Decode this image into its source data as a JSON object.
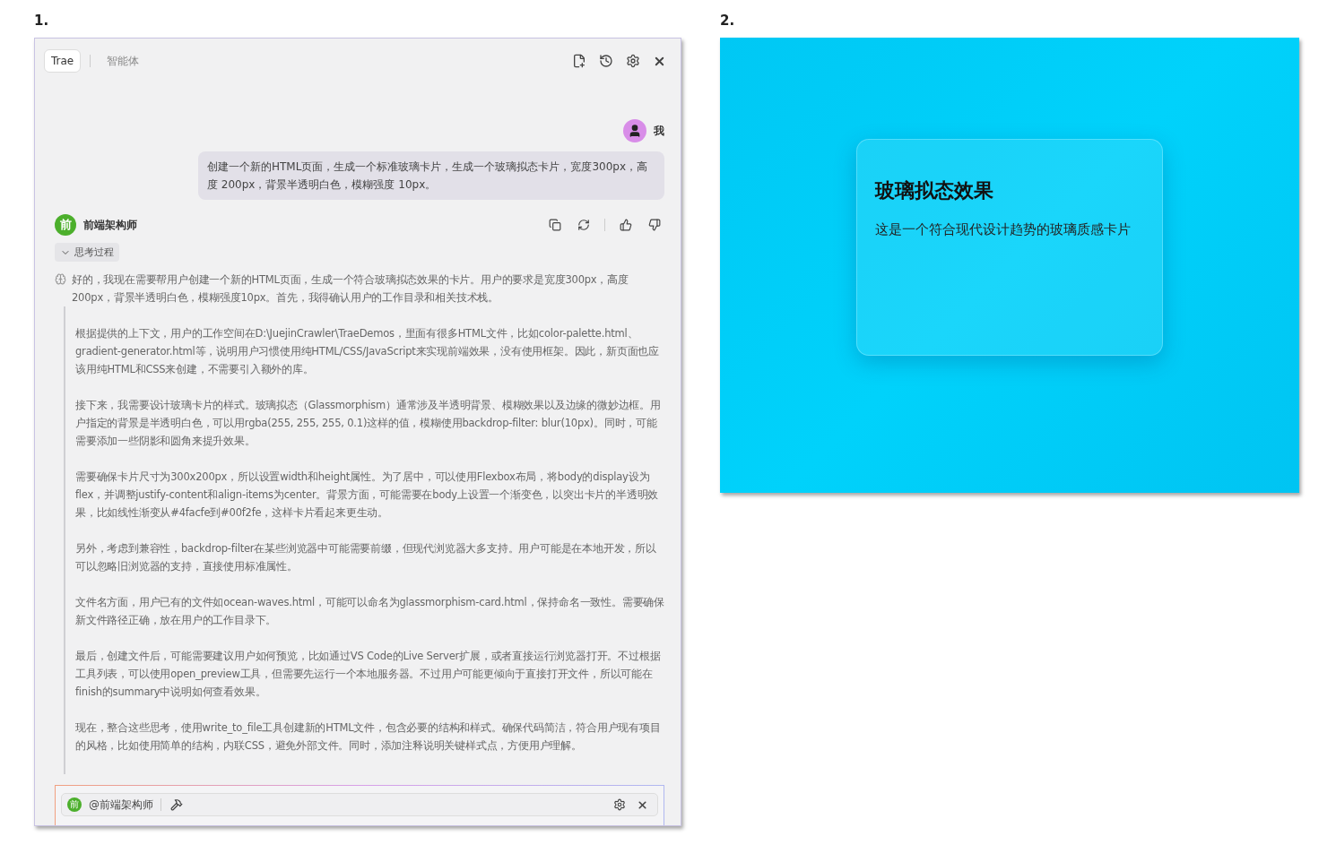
{
  "figures": [
    {
      "label": "1."
    },
    {
      "label": "2."
    }
  ],
  "chat_panel": {
    "tabs": [
      {
        "label": "Trae",
        "selected": true
      },
      {
        "label": "智能体",
        "selected": false
      }
    ],
    "user_message": {
      "sender": "我",
      "text": "创建一个新的HTML页面，生成一个标准玻璃卡片，生成一个玻璃拟态卡片，宽度300px，高度 200px，背景半透明白色，模糊强度 10px。"
    },
    "agent": {
      "avatar_letter": "前",
      "name": "前端架构师"
    },
    "thinking": {
      "label": "思考过程",
      "expanded": true,
      "paragraphs": [
        "好的，我现在需要帮用户创建一个新的HTML页面，生成一个符合玻璃拟态效果的卡片。用户的要求是宽度300px，高度200px，背景半透明白色，模糊强度10px。首先，我得确认用户的工作目录和相关技术栈。",
        "根据提供的上下文，用户的工作空间在D:\\JuejinCrawler\\TraeDemos，里面有很多HTML文件，比如color-palette.html、gradient-generator.html等，说明用户习惯使用纯HTML/CSS/JavaScript来实现前端效果，没有使用框架。因此，新页面也应该用纯HTML和CSS来创建，不需要引入额外的库。",
        "接下来，我需要设计玻璃卡片的样式。玻璃拟态（Glassmorphism）通常涉及半透明背景、模糊效果以及边缘的微妙边框。用户指定的背景是半透明白色，可以用rgba(255, 255, 255, 0.1)这样的值，模糊使用backdrop-filter: blur(10px)。同时，可能需要添加一些阴影和圆角来提升效果。",
        "需要确保卡片尺寸为300x200px，所以设置width和height属性。为了居中，可以使用Flexbox布局，将body的display设为flex，并调整justify-content和align-items为center。背景方面，可能需要在body上设置一个渐变色，以突出卡片的半透明效果，比如线性渐变从#4facfe到#00f2fe，这样卡片看起来更生动。",
        "另外，考虑到兼容性，backdrop-filter在某些浏览器中可能需要前缀，但现代浏览器大多支持。用户可能是在本地开发，所以可以忽略旧浏览器的支持，直接使用标准属性。",
        "文件名方面，用户已有的文件如ocean-waves.html，可能可以命名为glassmorphism-card.html，保持命名一致性。需要确保新文件路径正确，放在用户的工作目录下。",
        "最后，创建文件后，可能需要建议用户如何预览，比如通过VS Code的Live Server扩展，或者直接运行浏览器打开。不过根据工具列表，可以使用open_preview工具，但需要先运行一个本地服务器。不过用户可能更倾向于直接打开文件，所以可能在finish的summary中说明如何查看效果。",
        "现在，整合这些思考，使用write_to_file工具创建新的HTML文件，包含必要的结构和样式。确保代码简洁，符合用户现有项目的风格，比如使用简单的结构，内联CSS，避免外部文件。同时，添加注释说明关键样式点，方便用户理解。"
      ]
    },
    "input": {
      "mention_letter": "前",
      "mention": "@前端架构师"
    }
  },
  "preview": {
    "card_title": "玻璃拟态效果",
    "card_text": "这是一个符合现代设计趋势的玻璃质感卡片"
  }
}
